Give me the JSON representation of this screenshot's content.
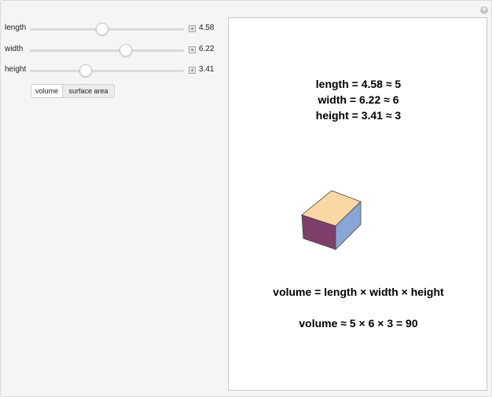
{
  "controls": {
    "sliders": [
      {
        "label": "length",
        "value": "4.58",
        "fraction": 0.47
      },
      {
        "label": "width",
        "value": "6.22",
        "fraction": 0.62
      },
      {
        "label": "height",
        "value": "3.41",
        "fraction": 0.36
      }
    ],
    "plus_symbol": "+",
    "mode_buttons": {
      "volume": "volume",
      "surface_area": "surface area",
      "selected": "volume"
    }
  },
  "display": {
    "dims": {
      "length": "length = 4.58 ≈ 5",
      "width": "width = 6.22 ≈ 6",
      "height": "height = 3.41 ≈ 3"
    },
    "formula": "volume = length × width × height",
    "result": "volume ≈ 5 × 6 × 3 = 90",
    "box_colors": {
      "top": "#fbd7a6",
      "front": "#7e3f6b",
      "side": "#8aa6d6"
    }
  },
  "corner_icon": "+"
}
